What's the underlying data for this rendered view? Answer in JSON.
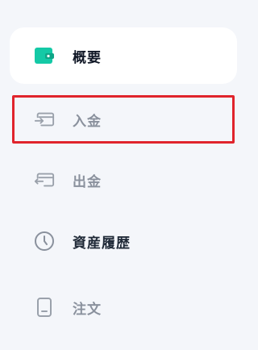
{
  "sidebar": {
    "items": [
      {
        "label": "概要",
        "icon": "wallet-icon",
        "state": "active"
      },
      {
        "label": "入金",
        "icon": "deposit-icon",
        "state": "highlighted"
      },
      {
        "label": "出金",
        "icon": "withdraw-icon",
        "state": "normal"
      },
      {
        "label": "資産履歴",
        "icon": "clock-icon",
        "state": "normal"
      },
      {
        "label": "注文",
        "icon": "document-icon",
        "state": "normal"
      }
    ]
  },
  "colors": {
    "accent": "#14c9a6",
    "highlight_border": "#e0242c",
    "muted_text": "#8a919d",
    "background": "#f4f6fa"
  }
}
